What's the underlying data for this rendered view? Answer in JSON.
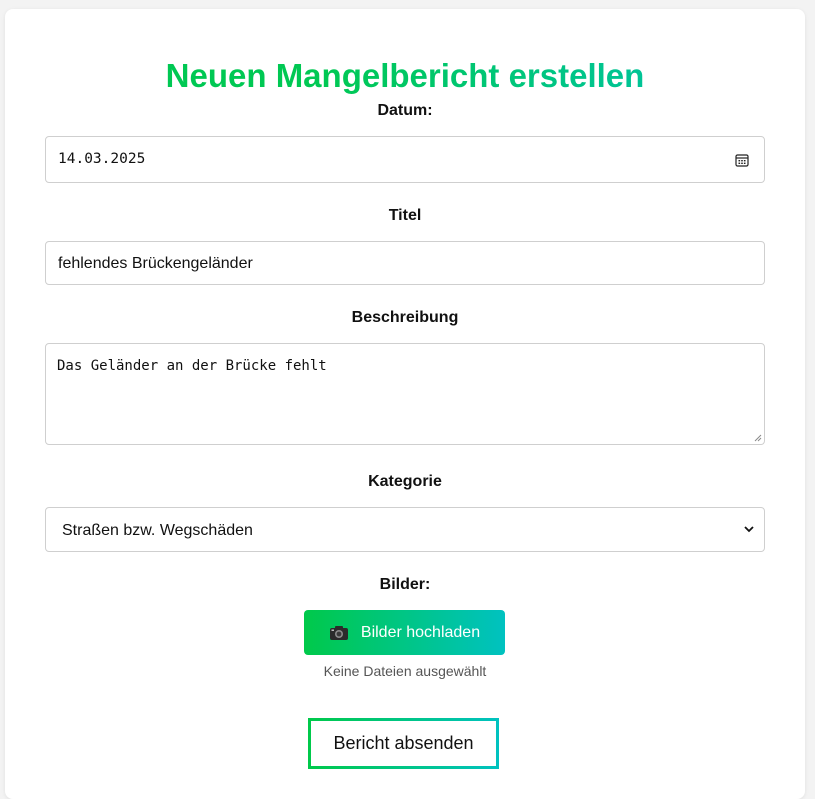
{
  "form": {
    "title": "Neuen Mangelbericht erstellen",
    "date_label": "Datum:",
    "date_value": "14.03.2025",
    "title_label": "Titel",
    "title_value": "fehlendes Brückengeländer",
    "description_label": "Beschreibung",
    "description_value": "Das Geländer an der Brücke fehlt",
    "category_label": "Kategorie",
    "category_value": "Straßen bzw. Wegschäden",
    "images_label": "Bilder:",
    "upload_button_label": "Bilder hochladen",
    "no_files_text": "Keine Dateien ausgewählt",
    "submit_button_label": "Bericht absenden"
  },
  "icons": {
    "calendar": "calendar-icon",
    "camera": "camera-icon",
    "dropdown": "chevron-down-icon",
    "resize": "resize-handle-icon"
  },
  "colors": {
    "accent_green": "#00c853",
    "accent_teal": "#00c2c0",
    "text": "#111111",
    "muted_text": "#555555",
    "border": "#cfcfcf"
  }
}
